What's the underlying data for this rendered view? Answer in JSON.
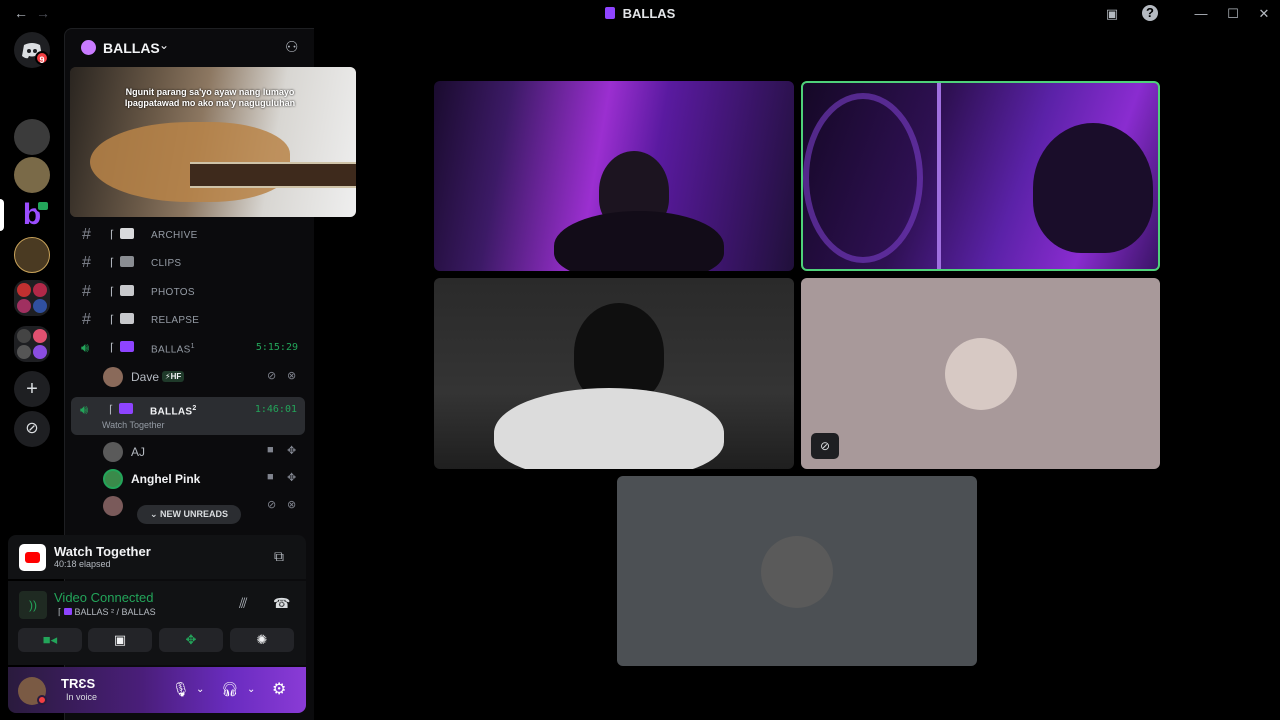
{
  "window": {
    "title": "BALLAS",
    "nav_back": "←",
    "nav_forward": "→",
    "controls": {
      "minimize": "—",
      "maximize": "☐",
      "close": "✕"
    },
    "help_icon": "?"
  },
  "rail": {
    "home_badge": "9"
  },
  "server": {
    "name": "BALLAS"
  },
  "popout": {
    "lyric_line1": "Ngunit parang sa'yo ayaw nang lumayo",
    "lyric_line2": "Ipagpatawad mo ako ma'y naguguluhan"
  },
  "channels": [
    {
      "label": "ARCHIVE"
    },
    {
      "label": "CLIPS"
    },
    {
      "label": "PHOTOS"
    },
    {
      "label": "RELAPSE"
    },
    {
      "label": "BALLAS",
      "sup": "1",
      "time": "5:15:29"
    },
    {
      "label": "BALLAS",
      "sup": "2",
      "time": "1:46:01",
      "subtitle": "Watch Together"
    }
  ],
  "members": [
    {
      "name": "Dave",
      "tag": "⚡HF"
    },
    {
      "name": "AJ"
    },
    {
      "name": "Anghel Pink"
    }
  ],
  "new_unreads": "NEW UNREADS",
  "watch_together": {
    "title": "Watch Together",
    "elapsed": "40:18 elapsed"
  },
  "voice": {
    "status": "Video Connected",
    "location": "BALLAS ² / BALLAS"
  },
  "user": {
    "name": "TRƐS",
    "status": "In voice"
  },
  "colors": {
    "accent_green": "#23a55a",
    "speaking_border": "#4fd17a",
    "danger": "#f23f43"
  }
}
